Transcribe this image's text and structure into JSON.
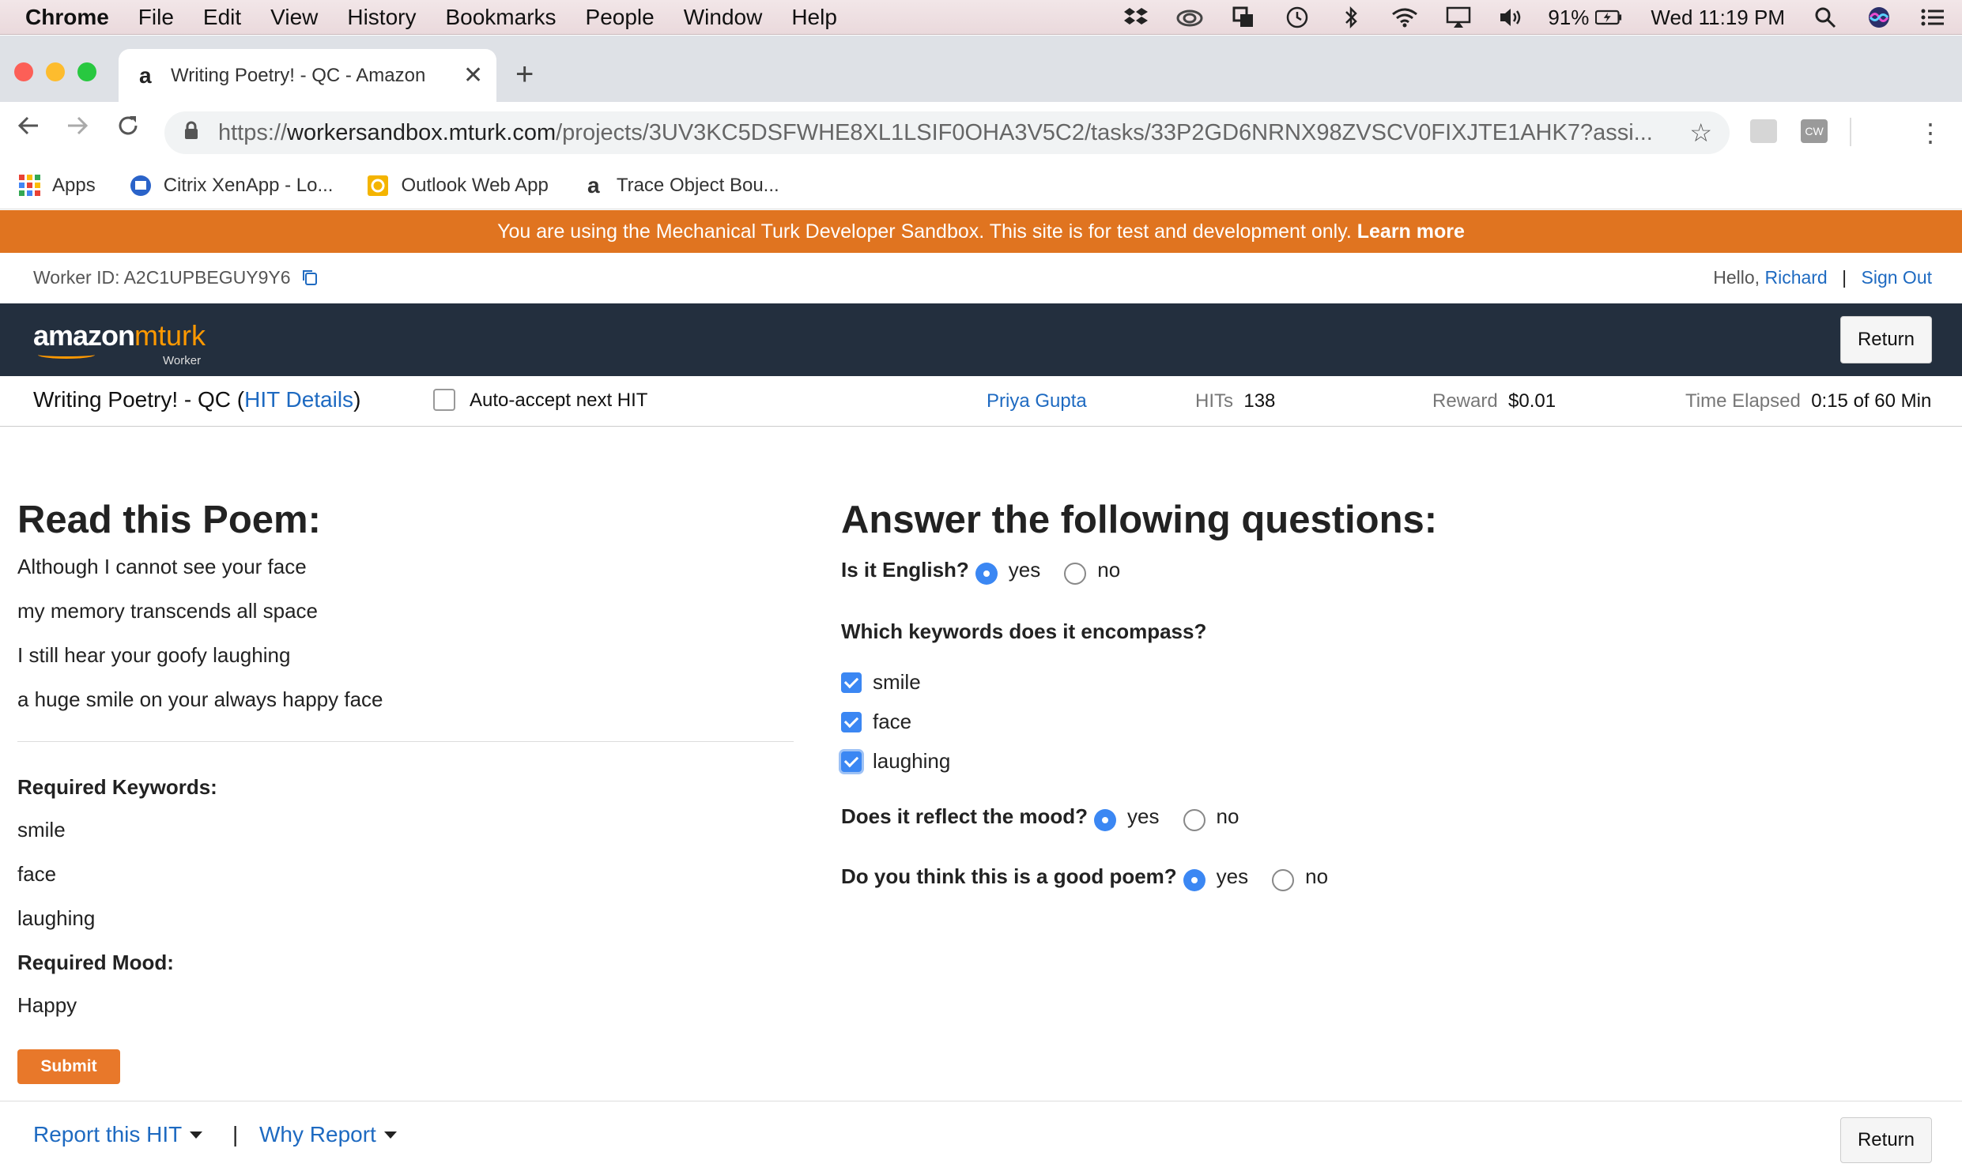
{
  "menubar": {
    "app": "Chrome",
    "items": [
      "File",
      "Edit",
      "View",
      "History",
      "Bookmarks",
      "People",
      "Window",
      "Help"
    ],
    "battery": "91%",
    "clock": "Wed 11:19 PM"
  },
  "browser": {
    "tab_title": "Writing Poetry! - QC - Amazon",
    "url_scheme": "https://",
    "url_host": "workersandbox.mturk.com",
    "url_path": "/projects/3UV3KC5DSFWHE8XL1LSIF0OHA3V5C2/tasks/33P2GD6NRNX98ZVSCV0FIXJTE1AHK7?assi...",
    "extension_label": "CW",
    "bookmarks": [
      "Apps",
      "Citrix XenApp - Lo...",
      "Outlook Web App",
      "Trace Object Bou..."
    ]
  },
  "page": {
    "banner_text": "You are using the Mechanical Turk Developer Sandbox. This site is for test and development only.",
    "banner_link": "Learn more",
    "worker_id": "Worker ID: A2C1UPBEGUY9Y6",
    "hello": "Hello,",
    "user_name": "Richard",
    "separator": "|",
    "sign_out": "Sign Out",
    "logo_amazon": "amazon",
    "logo_mturk": "mturk",
    "logo_sub": "Worker",
    "return_label": "Return"
  },
  "hit": {
    "title": "Writing Poetry! - QC (",
    "details_link": "HIT Details",
    "title_close": ")",
    "auto_accept": "Auto-accept next HIT",
    "requester": "Priya Gupta",
    "hits_label": "HITs",
    "hits_value": "138",
    "reward_label": "Reward",
    "reward_value": "$0.01",
    "time_label": "Time Elapsed",
    "time_value": "0:15 of 60 Min"
  },
  "task": {
    "poem_heading": "Read this Poem:",
    "poem_lines": [
      "Although I cannot see your face",
      "my memory transcends all space",
      "I still hear your goofy laughing",
      "a huge smile on your always happy face"
    ],
    "keywords_heading": "Required Keywords:",
    "keywords": [
      "smile",
      "face",
      "laughing"
    ],
    "mood_heading": "Required Mood:",
    "mood": "Happy",
    "submit_label": "Submit",
    "questions_heading": "Answer the following questions:",
    "q_english": "Is it English?",
    "q_keywords": "Which keywords does it encompass?",
    "q_mood": "Does it reflect the mood?",
    "q_good": "Do you think this is a good poem?",
    "yes": "yes",
    "no": "no",
    "checked_keywords": [
      "smile",
      "face",
      "laughing"
    ]
  },
  "footer": {
    "report": "Report this HIT",
    "why_report": "Why Report",
    "separator": "|",
    "return_label": "Return"
  }
}
